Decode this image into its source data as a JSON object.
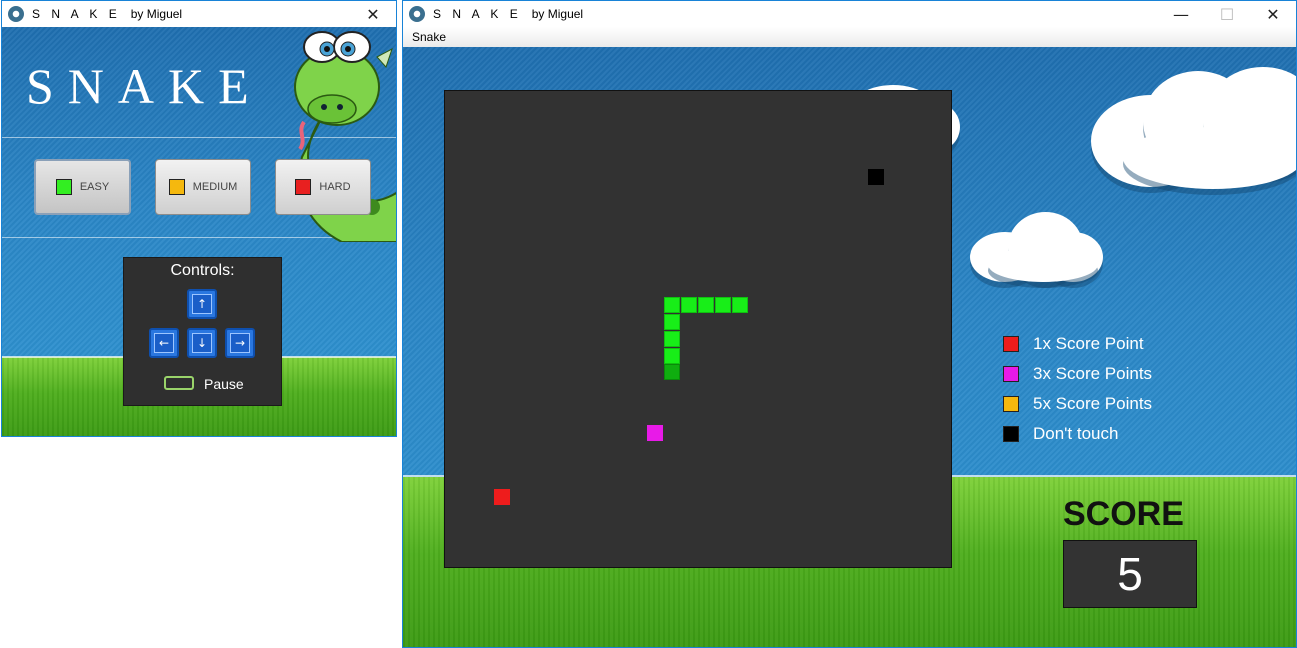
{
  "menu_window": {
    "title_prefix": "S N A K E",
    "title_suffix": "by Miguel",
    "close_glyph": "✕",
    "logo_text": "SNAKE",
    "difficulties": [
      {
        "label": "EASY",
        "color": "#33ee22",
        "selected": true
      },
      {
        "label": "MEDIUM",
        "color": "#f5b80e",
        "selected": false
      },
      {
        "label": "HARD",
        "color": "#e82020",
        "selected": false
      }
    ],
    "controls": {
      "title": "Controls:",
      "up_glyph": "↑",
      "left_glyph": "←",
      "down_glyph": "↓",
      "right_glyph": "→",
      "pause_label": "Pause"
    }
  },
  "game_window": {
    "title_prefix": "S N A K E",
    "title_suffix": "by Miguel",
    "minimize_glyph": "—",
    "maximize_glyph": "☐",
    "close_glyph": "✕",
    "menu_items": [
      "Snake"
    ],
    "legend": [
      {
        "color": "#ee1c1c",
        "label": "1x Score Point"
      },
      {
        "color": "#e81ae8",
        "label": "3x Score Points"
      },
      {
        "color": "#f5b80e",
        "label": "5x Score Points"
      },
      {
        "color": "#000000",
        "label": "Don't touch"
      }
    ],
    "score_label": "SCORE",
    "score_value": "5"
  },
  "colors": {
    "snake": "#18ee18",
    "snake_head": "#0fae0f",
    "board": "#323232",
    "accent": "#1883d7"
  }
}
